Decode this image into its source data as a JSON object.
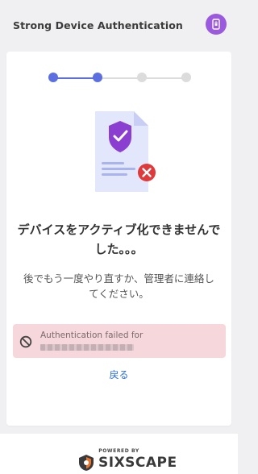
{
  "header": {
    "title": "Strong Device Authentication",
    "badge_icon": "device-lock-icon",
    "badge_color": "#9b59e0"
  },
  "stepper": {
    "total_steps": 4,
    "current_step": 2,
    "active_color": "#5b6fe0",
    "inactive_color": "#dcdcdc"
  },
  "illustration": {
    "icon": "document-shield-error-icon",
    "shield_color": "#8b3fd0",
    "error_color": "#e0393b"
  },
  "message": {
    "title": "デバイスをアクティブ化できませんでした。。。",
    "subtitle": "後でもう一度やり直すか、管理者に連絡してください。"
  },
  "error": {
    "icon": "prohibited-icon",
    "text": "Authentication failed for",
    "background": "#f6d7db"
  },
  "back_link": {
    "label": "戻る"
  },
  "footer": {
    "powered_by": "POWERED BY",
    "brand": "SIXSCAPE"
  }
}
